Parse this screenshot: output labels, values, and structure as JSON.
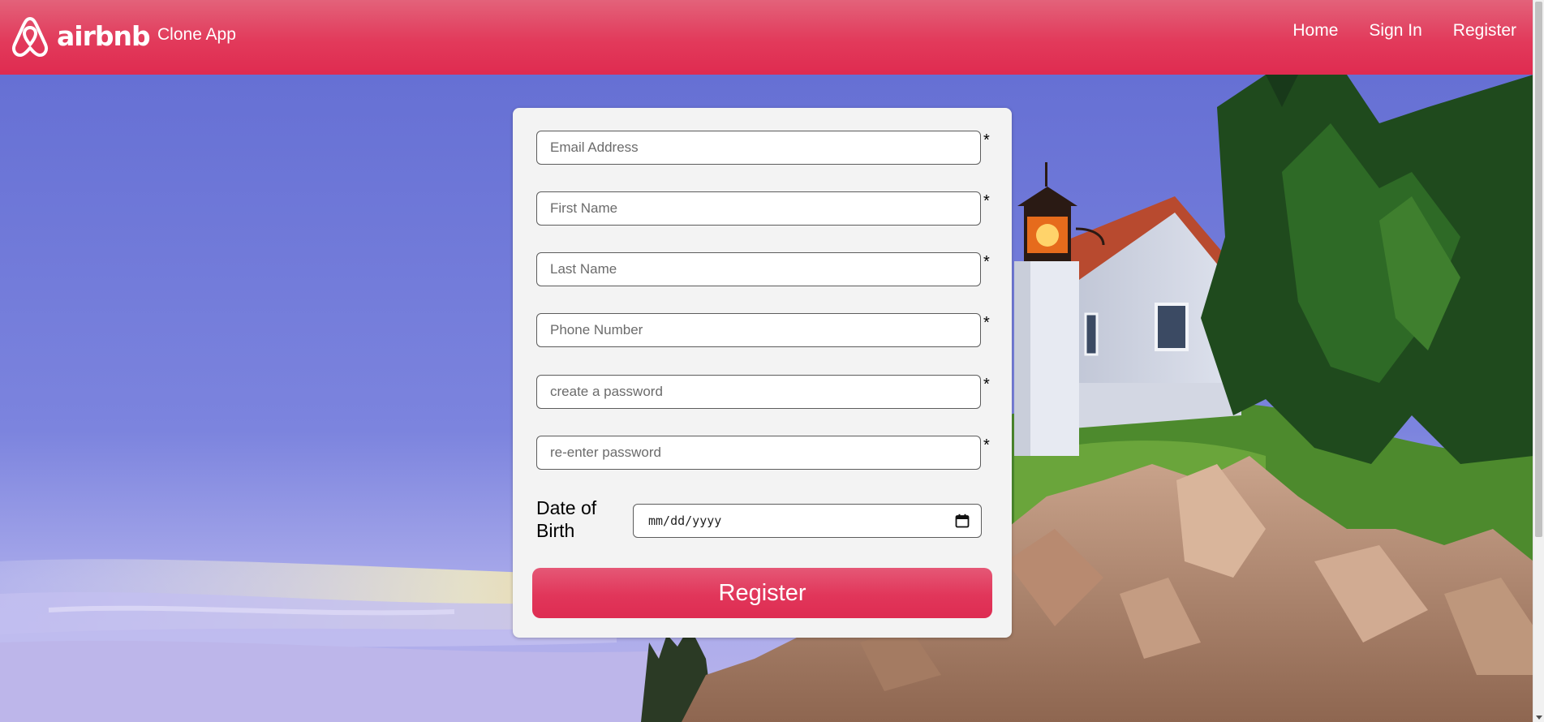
{
  "header": {
    "logo_text": "airbnb",
    "app_name": "Clone App",
    "nav": [
      {
        "label": "Home"
      },
      {
        "label": "Sign In"
      },
      {
        "label": "Register"
      }
    ]
  },
  "form": {
    "fields": [
      {
        "placeholder": "Email Address",
        "value": "",
        "required_mark": "*"
      },
      {
        "placeholder": "First Name",
        "value": "",
        "required_mark": "*"
      },
      {
        "placeholder": "Last Name",
        "value": "",
        "required_mark": "*"
      },
      {
        "placeholder": "Phone Number",
        "value": "",
        "required_mark": "*"
      },
      {
        "placeholder": "create a password",
        "value": "",
        "required_mark": "*"
      },
      {
        "placeholder": "re-enter password",
        "value": "",
        "required_mark": "*"
      }
    ],
    "dob_label": "Date of Birth",
    "dob_value": "mm/dd/yyyy",
    "submit_label": "Register"
  },
  "colors": {
    "brand": "#e23a5b",
    "card": "#f3f3f3"
  },
  "icons": {
    "logo": "airbnb-logo-icon",
    "date": "calendar-icon"
  }
}
